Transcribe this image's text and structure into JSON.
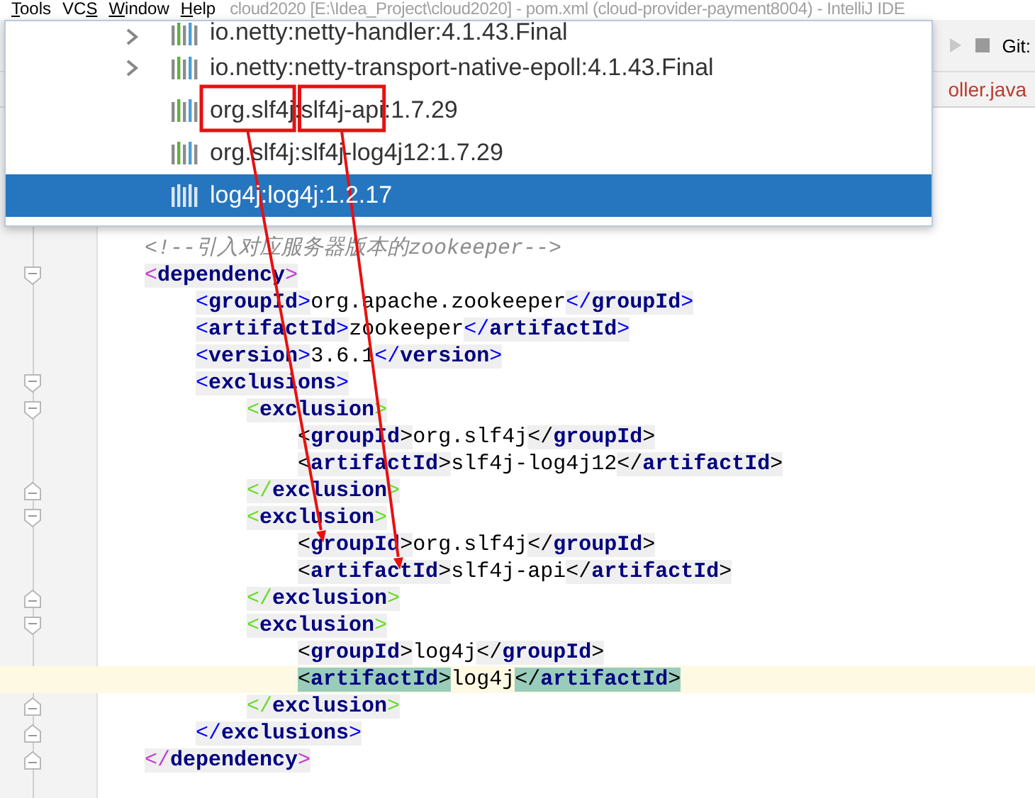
{
  "menu_bar": {
    "items": [
      {
        "parts": [
          {
            "text": "T",
            "underlined": true
          },
          {
            "text": "ools"
          }
        ]
      },
      {
        "parts": [
          {
            "text": "VC"
          },
          {
            "text": "S",
            "underlined": true
          }
        ]
      },
      {
        "parts": [
          {
            "text": "W",
            "underlined": true
          },
          {
            "text": "indow"
          }
        ]
      },
      {
        "parts": [
          {
            "text": "H",
            "underlined": true
          },
          {
            "text": "elp"
          }
        ]
      }
    ],
    "title": "cloud2020 [E:\\Idea_Project\\cloud2020] - pom.xml (cloud-provider-payment8004) - IntelliJ IDE"
  },
  "toolbar": {
    "vcs_label": "Git:"
  },
  "editor_tab": {
    "label": "oller.java"
  },
  "popup": {
    "items": [
      {
        "parts": [
          {
            "text": "io.netty:netty-handler:4.1.43.Final"
          }
        ],
        "expandable": true,
        "selected": false
      },
      {
        "parts": [
          {
            "text": "io.netty:netty-transport-native-epoll:4.1.43.Final"
          }
        ],
        "expandable": true,
        "selected": false
      },
      {
        "parts": [
          {
            "text": "org.slf4j",
            "boxed": true,
            "arrow": true
          },
          {
            "text": ":"
          },
          {
            "text": "slf4j-api",
            "boxed": true,
            "arrow": true
          },
          {
            "text": ":1.7.29"
          }
        ],
        "expandable": false,
        "selected": false
      },
      {
        "parts": [
          {
            "text": "org.slf4j:slf4j-log4j12:1.7.29"
          }
        ],
        "expandable": false,
        "selected": false
      },
      {
        "parts": [
          {
            "text": "log4j:log4j:1.2.17"
          }
        ],
        "expandable": false,
        "selected": true
      }
    ]
  },
  "code": {
    "lines": [
      {
        "tokens": [
          {
            "kind": "comment",
            "text": "<!--引入对应服务器版本的zookeeper-->"
          }
        ]
      },
      {
        "fold_start": true,
        "tokens": [
          {
            "kind": "tag",
            "text": "<dependency>",
            "color": "#c03ccf"
          }
        ]
      },
      {
        "tokens": [
          {
            "kind": "tag",
            "text": "    <groupId>",
            "color": "#0000ff"
          },
          {
            "kind": "value",
            "text": "org.apache.zookeeper"
          },
          {
            "kind": "tag",
            "text": "</groupId>",
            "color": "#0000ff"
          }
        ]
      },
      {
        "tokens": [
          {
            "kind": "tag",
            "text": "    <artifactId>",
            "color": "#0000ff"
          },
          {
            "kind": "value",
            "text": "zookeeper"
          },
          {
            "kind": "tag",
            "text": "</artifactId>",
            "color": "#0000ff"
          }
        ]
      },
      {
        "tokens": [
          {
            "kind": "tag",
            "text": "    <version>",
            "color": "#0000ff"
          },
          {
            "kind": "value",
            "text": "3.6.1"
          },
          {
            "kind": "tag",
            "text": "</version>",
            "color": "#0000ff"
          }
        ]
      },
      {
        "fold_start": true,
        "tokens": [
          {
            "kind": "tag",
            "text": "    <exclusions>",
            "color": "#0000ff"
          }
        ]
      },
      {
        "fold_start": true,
        "tokens": [
          {
            "kind": "tag",
            "text": "        <exclusion>",
            "color": "#66dd22"
          }
        ]
      },
      {
        "tokens": [
          {
            "kind": "tag",
            "text": "            <groupId>",
            "color": "#000000"
          },
          {
            "kind": "value",
            "text": "org.slf4j"
          },
          {
            "kind": "tag",
            "text": "</groupId>",
            "color": "#000000"
          }
        ]
      },
      {
        "tokens": [
          {
            "kind": "tag",
            "text": "            <artifactId>",
            "color": "#000000"
          },
          {
            "kind": "value",
            "text": "slf4j-log4j12"
          },
          {
            "kind": "tag",
            "text": "</artifactId>",
            "color": "#000000"
          }
        ]
      },
      {
        "fold_end": true,
        "tokens": [
          {
            "kind": "tag",
            "text": "        </exclusion>",
            "color": "#66dd22"
          }
        ]
      },
      {
        "fold_start": true,
        "tokens": [
          {
            "kind": "tag",
            "text": "        <exclusion>",
            "color": "#66dd22"
          }
        ]
      },
      {
        "tokens": [
          {
            "kind": "tag",
            "text": "            <groupId>",
            "color": "#000000",
            "arrow_target": true
          },
          {
            "kind": "value",
            "text": "org.slf4j"
          },
          {
            "kind": "tag",
            "text": "</groupId>",
            "color": "#000000"
          }
        ]
      },
      {
        "tokens": [
          {
            "kind": "tag",
            "text": "            <artifactId>",
            "color": "#000000",
            "arrow_target": true
          },
          {
            "kind": "value",
            "text": "slf4j-api"
          },
          {
            "kind": "tag",
            "text": "</artifactId>",
            "color": "#000000"
          }
        ]
      },
      {
        "fold_end": true,
        "tokens": [
          {
            "kind": "tag",
            "text": "        </exclusion>",
            "color": "#66dd22"
          }
        ]
      },
      {
        "fold_start": true,
        "tokens": [
          {
            "kind": "tag",
            "text": "        <exclusion>",
            "color": "#66dd22"
          }
        ]
      },
      {
        "tokens": [
          {
            "kind": "tag",
            "text": "            <groupId>",
            "color": "#000000"
          },
          {
            "kind": "value",
            "text": "log4j"
          },
          {
            "kind": "tag",
            "text": "</groupId>",
            "color": "#000000"
          }
        ]
      },
      {
        "current": true,
        "tokens": [
          {
            "kind": "tag",
            "text": "            <artifactId>",
            "matched": true
          },
          {
            "kind": "value",
            "text": "log4j"
          },
          {
            "kind": "tag",
            "text": "</artifactId>",
            "matched": true
          }
        ]
      },
      {
        "fold_end": true,
        "tokens": [
          {
            "kind": "tag",
            "text": "        </exclusion>",
            "color": "#66dd22"
          }
        ]
      },
      {
        "fold_end": true,
        "tokens": [
          {
            "kind": "tag",
            "text": "    </exclusions>",
            "color": "#0000ff"
          }
        ]
      },
      {
        "fold_end": true,
        "tokens": [
          {
            "kind": "tag",
            "text": "</dependency>",
            "color": "#c03ccf"
          }
        ]
      }
    ]
  }
}
